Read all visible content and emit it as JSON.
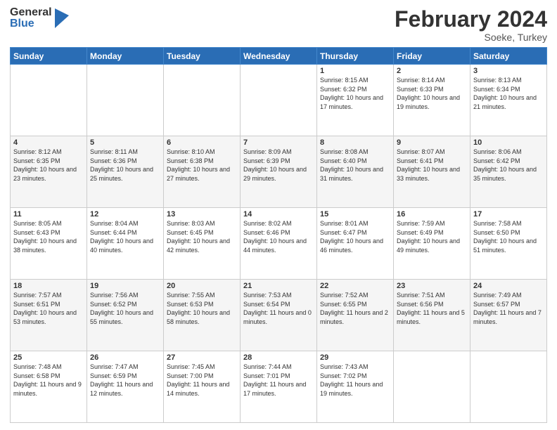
{
  "header": {
    "logo_general": "General",
    "logo_blue": "Blue",
    "title": "February 2024",
    "location": "Soeke, Turkey"
  },
  "weekdays": [
    "Sunday",
    "Monday",
    "Tuesday",
    "Wednesday",
    "Thursday",
    "Friday",
    "Saturday"
  ],
  "weeks": [
    [
      {
        "day": "",
        "info": ""
      },
      {
        "day": "",
        "info": ""
      },
      {
        "day": "",
        "info": ""
      },
      {
        "day": "",
        "info": ""
      },
      {
        "day": "1",
        "info": "Sunrise: 8:15 AM\nSunset: 6:32 PM\nDaylight: 10 hours\nand 17 minutes."
      },
      {
        "day": "2",
        "info": "Sunrise: 8:14 AM\nSunset: 6:33 PM\nDaylight: 10 hours\nand 19 minutes."
      },
      {
        "day": "3",
        "info": "Sunrise: 8:13 AM\nSunset: 6:34 PM\nDaylight: 10 hours\nand 21 minutes."
      }
    ],
    [
      {
        "day": "4",
        "info": "Sunrise: 8:12 AM\nSunset: 6:35 PM\nDaylight: 10 hours\nand 23 minutes."
      },
      {
        "day": "5",
        "info": "Sunrise: 8:11 AM\nSunset: 6:36 PM\nDaylight: 10 hours\nand 25 minutes."
      },
      {
        "day": "6",
        "info": "Sunrise: 8:10 AM\nSunset: 6:38 PM\nDaylight: 10 hours\nand 27 minutes."
      },
      {
        "day": "7",
        "info": "Sunrise: 8:09 AM\nSunset: 6:39 PM\nDaylight: 10 hours\nand 29 minutes."
      },
      {
        "day": "8",
        "info": "Sunrise: 8:08 AM\nSunset: 6:40 PM\nDaylight: 10 hours\nand 31 minutes."
      },
      {
        "day": "9",
        "info": "Sunrise: 8:07 AM\nSunset: 6:41 PM\nDaylight: 10 hours\nand 33 minutes."
      },
      {
        "day": "10",
        "info": "Sunrise: 8:06 AM\nSunset: 6:42 PM\nDaylight: 10 hours\nand 35 minutes."
      }
    ],
    [
      {
        "day": "11",
        "info": "Sunrise: 8:05 AM\nSunset: 6:43 PM\nDaylight: 10 hours\nand 38 minutes."
      },
      {
        "day": "12",
        "info": "Sunrise: 8:04 AM\nSunset: 6:44 PM\nDaylight: 10 hours\nand 40 minutes."
      },
      {
        "day": "13",
        "info": "Sunrise: 8:03 AM\nSunset: 6:45 PM\nDaylight: 10 hours\nand 42 minutes."
      },
      {
        "day": "14",
        "info": "Sunrise: 8:02 AM\nSunset: 6:46 PM\nDaylight: 10 hours\nand 44 minutes."
      },
      {
        "day": "15",
        "info": "Sunrise: 8:01 AM\nSunset: 6:47 PM\nDaylight: 10 hours\nand 46 minutes."
      },
      {
        "day": "16",
        "info": "Sunrise: 7:59 AM\nSunset: 6:49 PM\nDaylight: 10 hours\nand 49 minutes."
      },
      {
        "day": "17",
        "info": "Sunrise: 7:58 AM\nSunset: 6:50 PM\nDaylight: 10 hours\nand 51 minutes."
      }
    ],
    [
      {
        "day": "18",
        "info": "Sunrise: 7:57 AM\nSunset: 6:51 PM\nDaylight: 10 hours\nand 53 minutes."
      },
      {
        "day": "19",
        "info": "Sunrise: 7:56 AM\nSunset: 6:52 PM\nDaylight: 10 hours\nand 55 minutes."
      },
      {
        "day": "20",
        "info": "Sunrise: 7:55 AM\nSunset: 6:53 PM\nDaylight: 10 hours\nand 58 minutes."
      },
      {
        "day": "21",
        "info": "Sunrise: 7:53 AM\nSunset: 6:54 PM\nDaylight: 11 hours\nand 0 minutes."
      },
      {
        "day": "22",
        "info": "Sunrise: 7:52 AM\nSunset: 6:55 PM\nDaylight: 11 hours\nand 2 minutes."
      },
      {
        "day": "23",
        "info": "Sunrise: 7:51 AM\nSunset: 6:56 PM\nDaylight: 11 hours\nand 5 minutes."
      },
      {
        "day": "24",
        "info": "Sunrise: 7:49 AM\nSunset: 6:57 PM\nDaylight: 11 hours\nand 7 minutes."
      }
    ],
    [
      {
        "day": "25",
        "info": "Sunrise: 7:48 AM\nSunset: 6:58 PM\nDaylight: 11 hours\nand 9 minutes."
      },
      {
        "day": "26",
        "info": "Sunrise: 7:47 AM\nSunset: 6:59 PM\nDaylight: 11 hours\nand 12 minutes."
      },
      {
        "day": "27",
        "info": "Sunrise: 7:45 AM\nSunset: 7:00 PM\nDaylight: 11 hours\nand 14 minutes."
      },
      {
        "day": "28",
        "info": "Sunrise: 7:44 AM\nSunset: 7:01 PM\nDaylight: 11 hours\nand 17 minutes."
      },
      {
        "day": "29",
        "info": "Sunrise: 7:43 AM\nSunset: 7:02 PM\nDaylight: 11 hours\nand 19 minutes."
      },
      {
        "day": "",
        "info": ""
      },
      {
        "day": "",
        "info": ""
      }
    ]
  ]
}
